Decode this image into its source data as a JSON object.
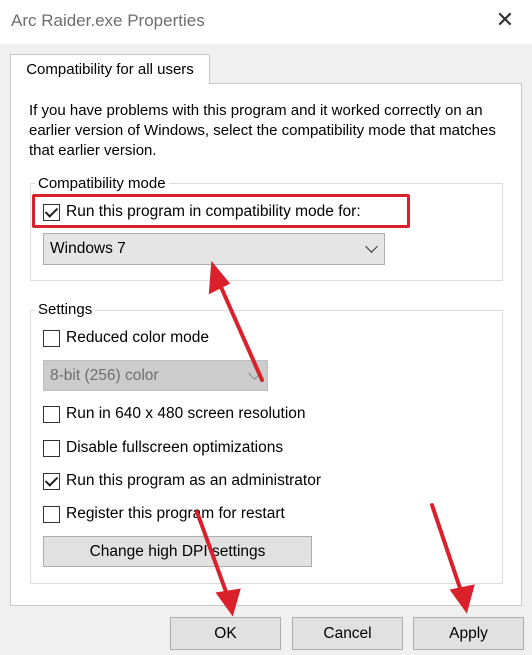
{
  "window": {
    "title": "Arc Raider.exe Properties"
  },
  "tab": {
    "label": "Compatibility for all users"
  },
  "intro_text": "If you have problems with this program and it worked correctly on an earlier version of Windows, select the compatibility mode that matches that earlier version.",
  "compat": {
    "group_label": "Compatibility mode",
    "checkbox_label": "Run this program in compatibility mode for:",
    "checked": true,
    "selected_os": "Windows 7"
  },
  "settings": {
    "group_label": "Settings",
    "reduced_color": {
      "label": "Reduced color mode",
      "checked": false
    },
    "color_select": "8-bit (256) color",
    "res640": {
      "label": "Run in 640 x 480 screen resolution",
      "checked": false
    },
    "fullscreen": {
      "label": "Disable fullscreen optimizations",
      "checked": false
    },
    "admin": {
      "label": "Run this program as an administrator",
      "checked": true
    },
    "restart": {
      "label": "Register this program for restart",
      "checked": false
    },
    "dpi_button": "Change high DPI settings"
  },
  "buttons": {
    "ok": "OK",
    "cancel": "Cancel",
    "apply": "Apply"
  },
  "colors": {
    "highlight": "#d9202b",
    "arrow": "#d9202b"
  }
}
